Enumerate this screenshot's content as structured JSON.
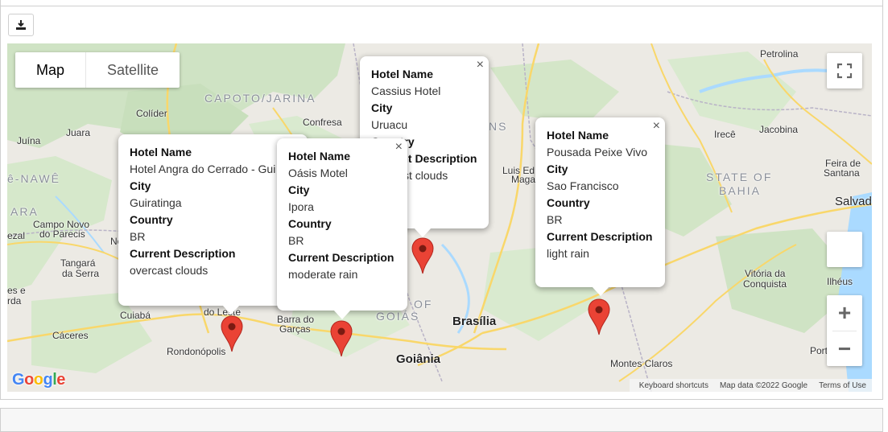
{
  "toolbar": {
    "download_icon": "download-icon"
  },
  "map": {
    "type_control": {
      "map_label": "Map",
      "satellite_label": "Satellite",
      "active": "Map"
    },
    "fullscreen_icon": "fullscreen-icon",
    "zoom_in_label": "+",
    "zoom_out_label": "−",
    "google_logo": "Google",
    "attribution": {
      "shortcuts": "Keyboard shortcuts",
      "data": "Map data ©2022 Google",
      "terms": "Terms of Use"
    },
    "colors": {
      "land": "#eceae4",
      "forest": "#cfe3c4",
      "water": "#aadaff",
      "road": "#f9d76a",
      "pin": "#ea4335"
    },
    "places": [
      {
        "name": "Petrolina"
      },
      {
        "name": "CAPOTO/JARINA"
      },
      {
        "name": "Colíder"
      },
      {
        "name": "Confresa"
      },
      {
        "name": "Juara"
      },
      {
        "name": "Juína"
      },
      {
        "name": "Irecê"
      },
      {
        "name": "Jacobina"
      },
      {
        "name": "Feira de"
      },
      {
        "name": "Santana"
      },
      {
        "name": "STATE OF"
      },
      {
        "name": "BAHIA"
      },
      {
        "name": "Salvad"
      },
      {
        "name": "Campo Novo"
      },
      {
        "name": "do Parecis"
      },
      {
        "name": "Tangará"
      },
      {
        "name": "da Serra"
      },
      {
        "name": "Cuiabá"
      },
      {
        "name": "Cáceres"
      },
      {
        "name": "Rondonópolis"
      },
      {
        "name": "Barra do"
      },
      {
        "name": "Garças"
      },
      {
        "name": "GOIÁS"
      },
      {
        "name": "Brasília"
      },
      {
        "name": "Goiânia"
      },
      {
        "name": "Montes Claros"
      },
      {
        "name": "Vitória da"
      },
      {
        "name": "Conquista"
      },
      {
        "name": "Ilhéus"
      },
      {
        "name": "Porto"
      },
      {
        "name": "Luis Ed"
      },
      {
        "name": "Magal"
      },
      {
        "name": "do Leste"
      },
      {
        "name": "ê-NAWÊ"
      },
      {
        "name": "ARA"
      },
      {
        "name": "ezal"
      },
      {
        "name": "es e"
      },
      {
        "name": "rda"
      },
      {
        "name": "OF"
      },
      {
        "name": "NS"
      },
      {
        "name": "No"
      }
    ],
    "infowindows": [
      {
        "labels": [
          "Hotel Name",
          "City",
          "Country",
          "Current Description"
        ],
        "hotel": "Hotel Angra do Cerrado - Gui",
        "city": "Guiratinga",
        "country": "BR",
        "description": "overcast clouds"
      },
      {
        "labels": [
          "Hotel Name",
          "City",
          "Country",
          "Current Description"
        ],
        "hotel": "Oásis Motel",
        "city": "Ipora",
        "country": "BR",
        "description": "moderate rain"
      },
      {
        "labels": [
          "Hotel Name",
          "City",
          "Country",
          "Current Description"
        ],
        "hotel": "Cassius Hotel",
        "city": "Uruacu",
        "country": "",
        "description": "st clouds"
      },
      {
        "labels": [
          "Hotel Name",
          "City",
          "Country",
          "Current Description"
        ],
        "hotel": "Pousada Peixe Vivo",
        "city": "Sao Francisco",
        "country": "BR",
        "description": "light rain"
      }
    ],
    "close_glyph": "×"
  }
}
